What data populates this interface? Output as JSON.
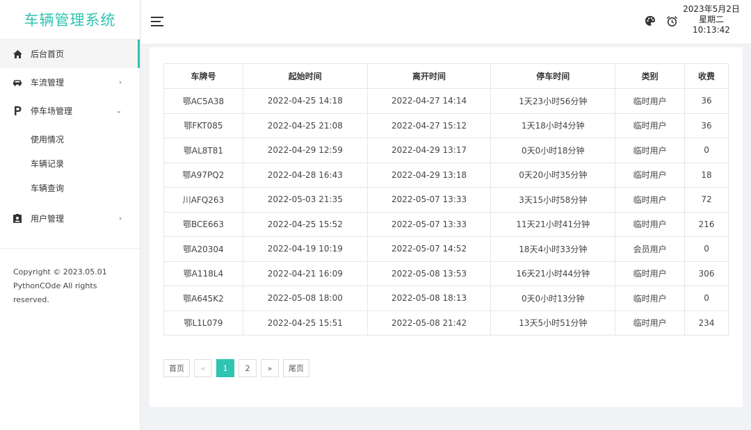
{
  "colors": {
    "accent": "#2fc3b2",
    "background": "#f1f2f5"
  },
  "sidebar": {
    "title": "车辆管理系统",
    "menu": [
      {
        "label": "后台首页",
        "icon": "home-icon",
        "active": true
      },
      {
        "label": "车流管理",
        "icon": "car-icon",
        "chevron": "›"
      },
      {
        "label": "停车场管理",
        "icon": "parking-icon",
        "chevron": "⌄",
        "submenu": [
          "使用情况",
          "车辆记录",
          "车辆查询"
        ]
      },
      {
        "label": "用户管理",
        "icon": "user-badge-icon",
        "chevron": "›"
      }
    ],
    "copyright": "Copyright © 2023.05.01 PythonCOde All rights reserved."
  },
  "header": {
    "menu_toggle_icon": "hamburger-icon",
    "theme_icon": "palette-icon",
    "alarm_icon": "alarm-clock-icon",
    "date": "2023年5月2日",
    "weekday": "星期二",
    "time": "10:13:42"
  },
  "table": {
    "columns": [
      "车牌号",
      "起始时间",
      "离开时间",
      "停车时间",
      "类别",
      "收费"
    ],
    "rows": [
      [
        "鄂AC5A38",
        "2022-04-25 14:18",
        "2022-04-27 14:14",
        "1天23小时56分钟",
        "临时用户",
        "36"
      ],
      [
        "鄂FKT085",
        "2022-04-25 21:08",
        "2022-04-27 15:12",
        "1天18小时4分钟",
        "临时用户",
        "36"
      ],
      [
        "鄂AL8T81",
        "2022-04-29 12:59",
        "2022-04-29 13:17",
        "0天0小时18分钟",
        "临时用户",
        "0"
      ],
      [
        "鄂A97PQ2",
        "2022-04-28 16:43",
        "2022-04-29 13:18",
        "0天20小时35分钟",
        "临时用户",
        "18"
      ],
      [
        "川AFQ263",
        "2022-05-03 21:35",
        "2022-05-07 13:33",
        "3天15小时58分钟",
        "临时用户",
        "72"
      ],
      [
        "鄂BCE663",
        "2022-04-25 15:52",
        "2022-05-07 13:33",
        "11天21小时41分钟",
        "临时用户",
        "216"
      ],
      [
        "鄂A20304",
        "2022-04-19 10:19",
        "2022-05-07 14:52",
        "18天4小时33分钟",
        "会员用户",
        "0"
      ],
      [
        "鄂A118L4",
        "2022-04-21 16:09",
        "2022-05-08 13:53",
        "16天21小时44分钟",
        "临时用户",
        "306"
      ],
      [
        "鄂A645K2",
        "2022-05-08 18:00",
        "2022-05-08 18:13",
        "0天0小时13分钟",
        "临时用户",
        "0"
      ],
      [
        "鄂L1L079",
        "2022-04-25 15:51",
        "2022-05-08 21:42",
        "13天5小时51分钟",
        "临时用户",
        "234"
      ]
    ]
  },
  "pagination": {
    "first": "首页",
    "prev": "«",
    "pages": [
      "1",
      "2"
    ],
    "current": "1",
    "next": "»",
    "last": "尾页"
  }
}
